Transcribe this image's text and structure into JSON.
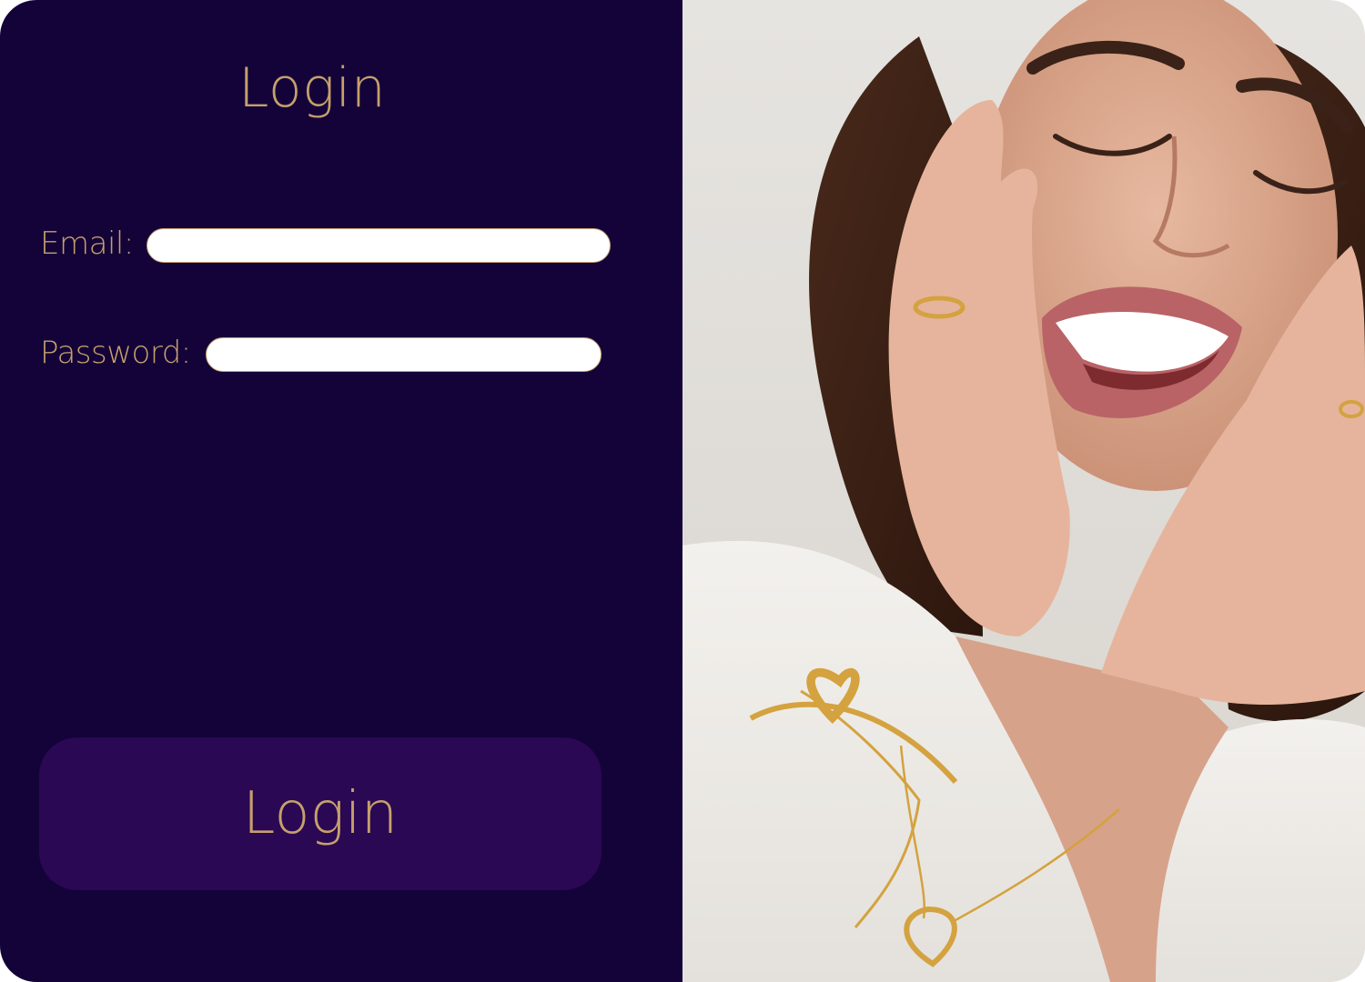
{
  "login_form": {
    "title": "Login",
    "email_label": "Email:",
    "password_label": "Password:",
    "email_value": "",
    "password_value": "",
    "submit_label": "Login"
  },
  "hero_photo": {
    "subject": "smiling woman wearing gold heart jewelry"
  },
  "colors": {
    "panel_background": "#130339",
    "button_background": "#2a0854",
    "accent_gold": "#c6a06c",
    "input_background": "#ffffff"
  }
}
